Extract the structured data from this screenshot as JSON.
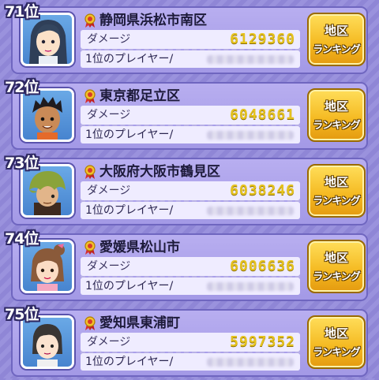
{
  "entries": [
    {
      "rank": "71位",
      "region": "静岡県浜松市南区",
      "damage_label": "ダメージ",
      "score": "6129360",
      "player_label": "1位のプレイヤー/",
      "button_line1": "地区",
      "button_line2": "ランキング",
      "avatar": "long-hair-teal-girl"
    },
    {
      "rank": "72位",
      "region": "東京都足立区",
      "damage_label": "ダメージ",
      "score": "6048661",
      "player_label": "1位のプレイヤー/",
      "button_line1": "地区",
      "button_line2": "ランキング",
      "avatar": "spiky-black-hair-boy"
    },
    {
      "rank": "73位",
      "region": "大阪府大阪市鶴見区",
      "damage_label": "ダメージ",
      "score": "6038246",
      "player_label": "1位のプレイヤー/",
      "button_line1": "地区",
      "button_line2": "ランキング",
      "avatar": "green-hooded-character"
    },
    {
      "rank": "74位",
      "region": "愛媛県松山市",
      "damage_label": "ダメージ",
      "score": "6006636",
      "player_label": "1位のプレイヤー/",
      "button_line1": "地区",
      "button_line2": "ランキング",
      "avatar": "brown-pigtail-girl"
    },
    {
      "rank": "75位",
      "region": "愛知県東浦町",
      "damage_label": "ダメージ",
      "score": "5997352",
      "player_label": "1位のプレイヤー/",
      "button_line1": "地区",
      "button_line2": "ランキング",
      "avatar": "dark-hair-woman"
    }
  ],
  "colors": {
    "background": "#9a92dd",
    "score": "#e5c21e",
    "button": "#f4b820"
  }
}
